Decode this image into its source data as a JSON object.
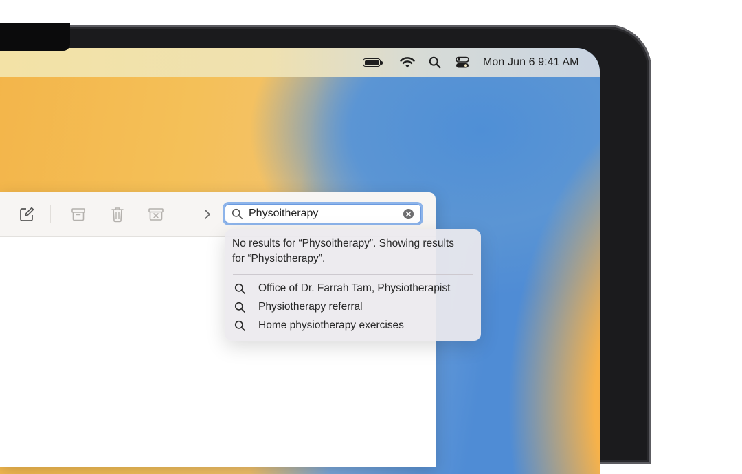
{
  "menubar": {
    "clock": "Mon Jun 6  9:41 AM",
    "icons": [
      "battery-icon",
      "wifi-icon",
      "spotlight-search-icon",
      "control-center-icon"
    ]
  },
  "toolbar": {
    "icons": [
      "compose-icon",
      "archive-icon",
      "trash-icon",
      "junk-icon",
      "chevron-right-icon"
    ]
  },
  "search": {
    "value": "Physoitherapy",
    "icon": "search-icon",
    "clear_icon": "clear-icon"
  },
  "popover": {
    "message": "No results for “Physoitherapy”. Showing results for “Physiotherapy”.",
    "suggestions": [
      {
        "label": "Office of Dr. Farrah Tam, Physiotherapist",
        "icon": "search-icon"
      },
      {
        "label": "Physiotherapy referral",
        "icon": "search-icon"
      },
      {
        "label": "Home physiotherapy exercises",
        "icon": "search-icon"
      }
    ]
  },
  "colors": {
    "accent_focus": "#8db4ea",
    "wallpaper_orange": "#f3b54a",
    "wallpaper_blue": "#4f8cd5"
  }
}
